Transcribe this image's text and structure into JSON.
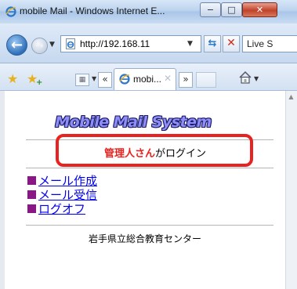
{
  "window": {
    "title": "mobile Mail - Windows Internet E...",
    "minimize_glyph": "−",
    "maximize_glyph": "□",
    "close_glyph": "✕"
  },
  "address_bar": {
    "url": "http://192.168.11",
    "search_text": "Live S"
  },
  "tabs": {
    "active_label": "mobi...",
    "close_glyph": "✕",
    "left_scroll": "«",
    "right_scroll": "»"
  },
  "page": {
    "logo_text": "Mobile Mail System",
    "login_user": "管理人さん",
    "login_suffix": "がログイン",
    "menu": [
      {
        "label": "メール作成"
      },
      {
        "label": "メール受信"
      },
      {
        "label": "ログオフ"
      }
    ],
    "footer": "岩手県立総合教育センター"
  },
  "colors": {
    "highlight": "#e8231f",
    "bullet": "#8b1686",
    "link": "#0000ee",
    "logo_fill": "#8e8ef6"
  },
  "icons": [
    "ie-icon",
    "back-icon",
    "forward-icon",
    "page-icon",
    "refresh-icon",
    "stop-icon",
    "favorites-star-icon",
    "add-favorites-icon",
    "quick-tabs-icon",
    "home-icon"
  ]
}
